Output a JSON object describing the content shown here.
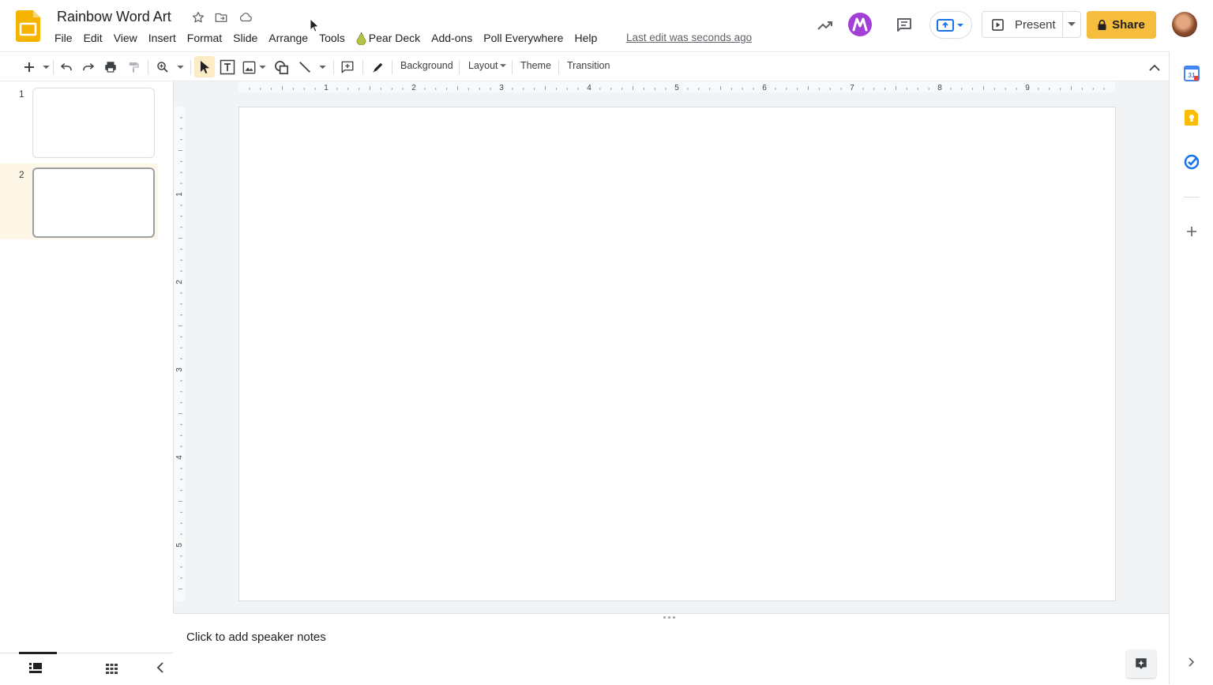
{
  "document": {
    "title": "Rainbow Word Art"
  },
  "menu": {
    "items": [
      "File",
      "Edit",
      "View",
      "Insert",
      "Format",
      "Slide",
      "Arrange",
      "Tools",
      "Pear Deck",
      "Add-ons",
      "Poll Everywhere",
      "Help"
    ],
    "last_edit": "Last edit was seconds ago"
  },
  "header": {
    "present_label": "Present",
    "share_label": "Share",
    "colors": {
      "share_bg": "#f6bc3d",
      "brand_slides": "#f4b400",
      "pear_deck": "#b5c24a",
      "extension_purple": "#a23fd6"
    }
  },
  "toolbar": {
    "background_label": "Background",
    "layout_label": "Layout",
    "theme_label": "Theme",
    "transition_label": "Transition"
  },
  "ruler": {
    "horizontal_ticks": [
      "1",
      "2",
      "3",
      "4",
      "5",
      "6",
      "7",
      "8",
      "9"
    ],
    "vertical_ticks": [
      "1",
      "2",
      "3",
      "4",
      "5"
    ]
  },
  "filmstrip": {
    "slides": [
      {
        "number": "1",
        "selected": false
      },
      {
        "number": "2",
        "selected": true
      }
    ]
  },
  "notes": {
    "placeholder": "Click to add speaker notes"
  },
  "side_panel": {
    "icons": [
      "calendar-icon",
      "keep-icon",
      "tasks-icon",
      "add-icon"
    ],
    "calendar_day": "31"
  }
}
